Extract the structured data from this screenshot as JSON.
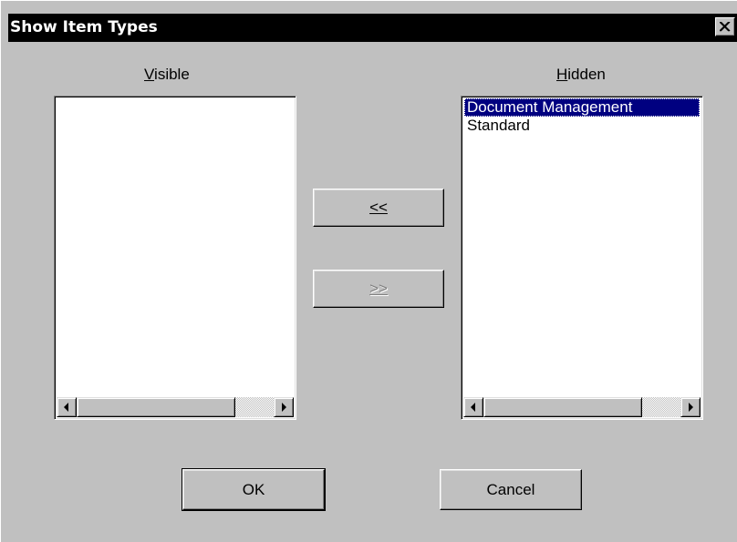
{
  "window": {
    "title": "Show Item Types",
    "close_icon": "close-icon"
  },
  "visible": {
    "label_underlined": "V",
    "label_rest": "isible",
    "items": []
  },
  "hidden": {
    "label_underlined": "H",
    "label_rest": "idden",
    "items": [
      {
        "label": "Document Management",
        "selected": true
      },
      {
        "label": "Standard",
        "selected": false
      }
    ]
  },
  "buttons": {
    "move_left": "<<",
    "move_right": ">>",
    "move_right_enabled": false,
    "ok": "OK",
    "cancel": "Cancel"
  },
  "icons": {
    "scroll_left": "triangle-left-icon",
    "scroll_right": "triangle-right-icon"
  },
  "colors": {
    "face": "#c0c0c0",
    "title_bar": "#000000",
    "selection": "#000080"
  }
}
